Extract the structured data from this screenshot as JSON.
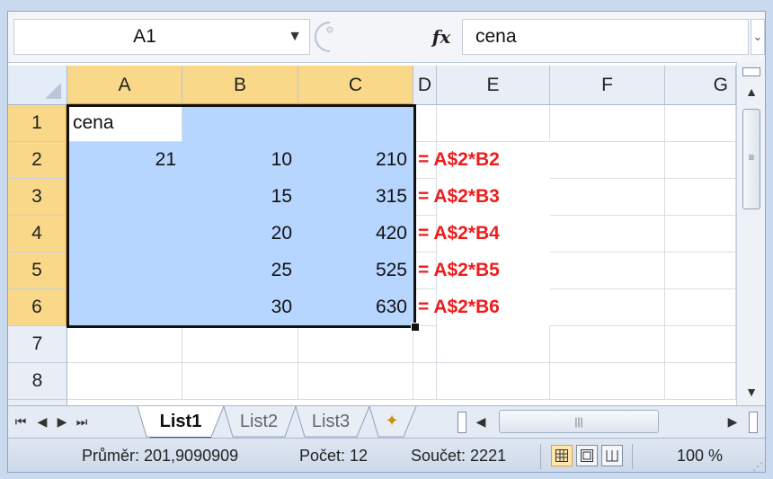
{
  "formula_bar": {
    "name_box": "A1",
    "fx_label": "fx",
    "formula": "cena"
  },
  "columns": [
    "A",
    "B",
    "C",
    "D",
    "E",
    "F",
    "G"
  ],
  "rows": [
    "1",
    "2",
    "3",
    "4",
    "5",
    "6",
    "7",
    "8"
  ],
  "cells": {
    "A1": "cena",
    "A2": "21",
    "B2": "10",
    "B3": "15",
    "B4": "20",
    "B5": "25",
    "B6": "30",
    "C2": "210",
    "C3": "315",
    "C4": "420",
    "C5": "525",
    "C6": "630",
    "D2": "= A$2*B2",
    "D3": "= A$2*B3",
    "D4": "= A$2*B4",
    "D5": "= A$2*B5",
    "D6": "= A$2*B6"
  },
  "sheet_tabs": [
    "List1",
    "List2",
    "List3"
  ],
  "active_sheet": "List1",
  "status_bar": {
    "average": "Průměr: 201,9090909",
    "count": "Počet: 12",
    "sum": "Součet: 2221",
    "zoom": "100 %"
  },
  "colors": {
    "selection": "#b6d5ff",
    "header_selected": "#f9d889",
    "annotation": "#ee1c1c"
  }
}
